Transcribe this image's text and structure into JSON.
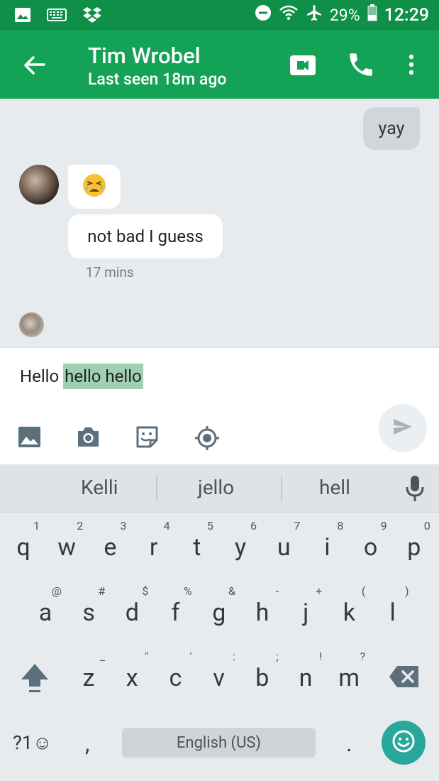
{
  "status_bar": {
    "battery": "29%",
    "time": "12:29",
    "icons": [
      "image-icon",
      "keyboard-icon",
      "dropbox-icon",
      "do-not-disturb-icon",
      "wifi-icon",
      "airplane-icon",
      "battery-icon"
    ]
  },
  "header": {
    "contact_name": "Tim Wrobel",
    "last_seen": "Last seen 18m ago"
  },
  "messages": {
    "outgoing_text": "yay",
    "incoming_emoji": "😫",
    "incoming_text": "not bad I guess",
    "incoming_time": "17 mins"
  },
  "compose": {
    "text_plain": "Hello ",
    "text_highlighted": "hello hello"
  },
  "suggestions": [
    "Kelli",
    "jello",
    "hell"
  ],
  "keyboard": {
    "row1": [
      {
        "ch": "q",
        "hint": "1"
      },
      {
        "ch": "w",
        "hint": "2"
      },
      {
        "ch": "e",
        "hint": "3"
      },
      {
        "ch": "r",
        "hint": "4"
      },
      {
        "ch": "t",
        "hint": "5"
      },
      {
        "ch": "y",
        "hint": "6"
      },
      {
        "ch": "u",
        "hint": "7"
      },
      {
        "ch": "i",
        "hint": "8"
      },
      {
        "ch": "o",
        "hint": "9"
      },
      {
        "ch": "p",
        "hint": "0"
      }
    ],
    "row2": [
      {
        "ch": "a",
        "hint": "@"
      },
      {
        "ch": "s",
        "hint": "#"
      },
      {
        "ch": "d",
        "hint": "$"
      },
      {
        "ch": "f",
        "hint": "%"
      },
      {
        "ch": "g",
        "hint": "&"
      },
      {
        "ch": "h",
        "hint": "-"
      },
      {
        "ch": "j",
        "hint": "+"
      },
      {
        "ch": "k",
        "hint": "("
      },
      {
        "ch": "l",
        "hint": ")"
      }
    ],
    "row3": [
      {
        "ch": "z",
        "hint": "_"
      },
      {
        "ch": "x",
        "hint": "\""
      },
      {
        "ch": "c",
        "hint": "'"
      },
      {
        "ch": "v",
        "hint": ":"
      },
      {
        "ch": "b",
        "hint": ";"
      },
      {
        "ch": "n",
        "hint": "!"
      },
      {
        "ch": "m",
        "hint": "?"
      }
    ],
    "symbols_label": "?1☺",
    "comma": ",",
    "space_label": "English (US)",
    "period": "."
  },
  "colors": {
    "status_bar": "#0f8f47",
    "app_bar": "#14a256",
    "emoji_key": "#27a89b",
    "highlight": "#9fd0b4"
  }
}
